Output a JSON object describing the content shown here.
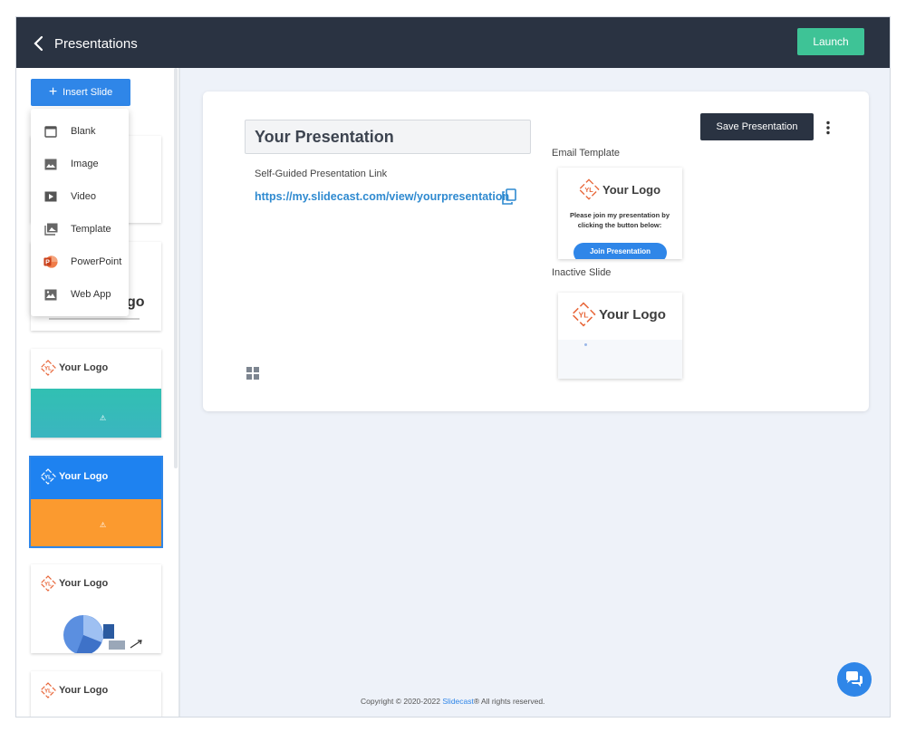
{
  "header": {
    "back_label": "Presentations",
    "launch_label": "Launch"
  },
  "sidebar": {
    "insert_label": "Insert Slide",
    "menu": [
      {
        "label": "Blank",
        "icon": "blank-icon"
      },
      {
        "label": "Image",
        "icon": "image-icon"
      },
      {
        "label": "Video",
        "icon": "video-icon"
      },
      {
        "label": "Template",
        "icon": "template-icon"
      },
      {
        "label": "PowerPoint",
        "icon": "powerpoint-icon"
      },
      {
        "label": "Web App",
        "icon": "web-app-icon"
      }
    ],
    "thumb2_partial": "go",
    "thumb_logo_text": "Your Logo",
    "logo_mark": "YL"
  },
  "main": {
    "title": "Your Presentation",
    "link_label": "Self-Guided Presentation Link",
    "link_url": "https://my.slidecast.com/view/yourpresentation",
    "save_label": "Save Presentation",
    "email_template_label": "Email Template",
    "email_logo_text": "Your Logo",
    "email_body": "Please join my presentation by clicking the button below:",
    "email_button": "Join Presentation",
    "inactive_label": "Inactive Slide",
    "inactive_logo_text": "Your Logo"
  },
  "footer": {
    "prefix": "Copyright © 2020-2022 ",
    "brand": "Slidecast",
    "suffix": "® All rights reserved."
  },
  "colors": {
    "topbar": "#2a3342",
    "launch": "#3ec396",
    "primary": "#2f86e8",
    "link": "#2f8ad0",
    "logo_orange": "#e8673a",
    "teal": "#36bfb0",
    "orange": "#fb9a2f"
  }
}
